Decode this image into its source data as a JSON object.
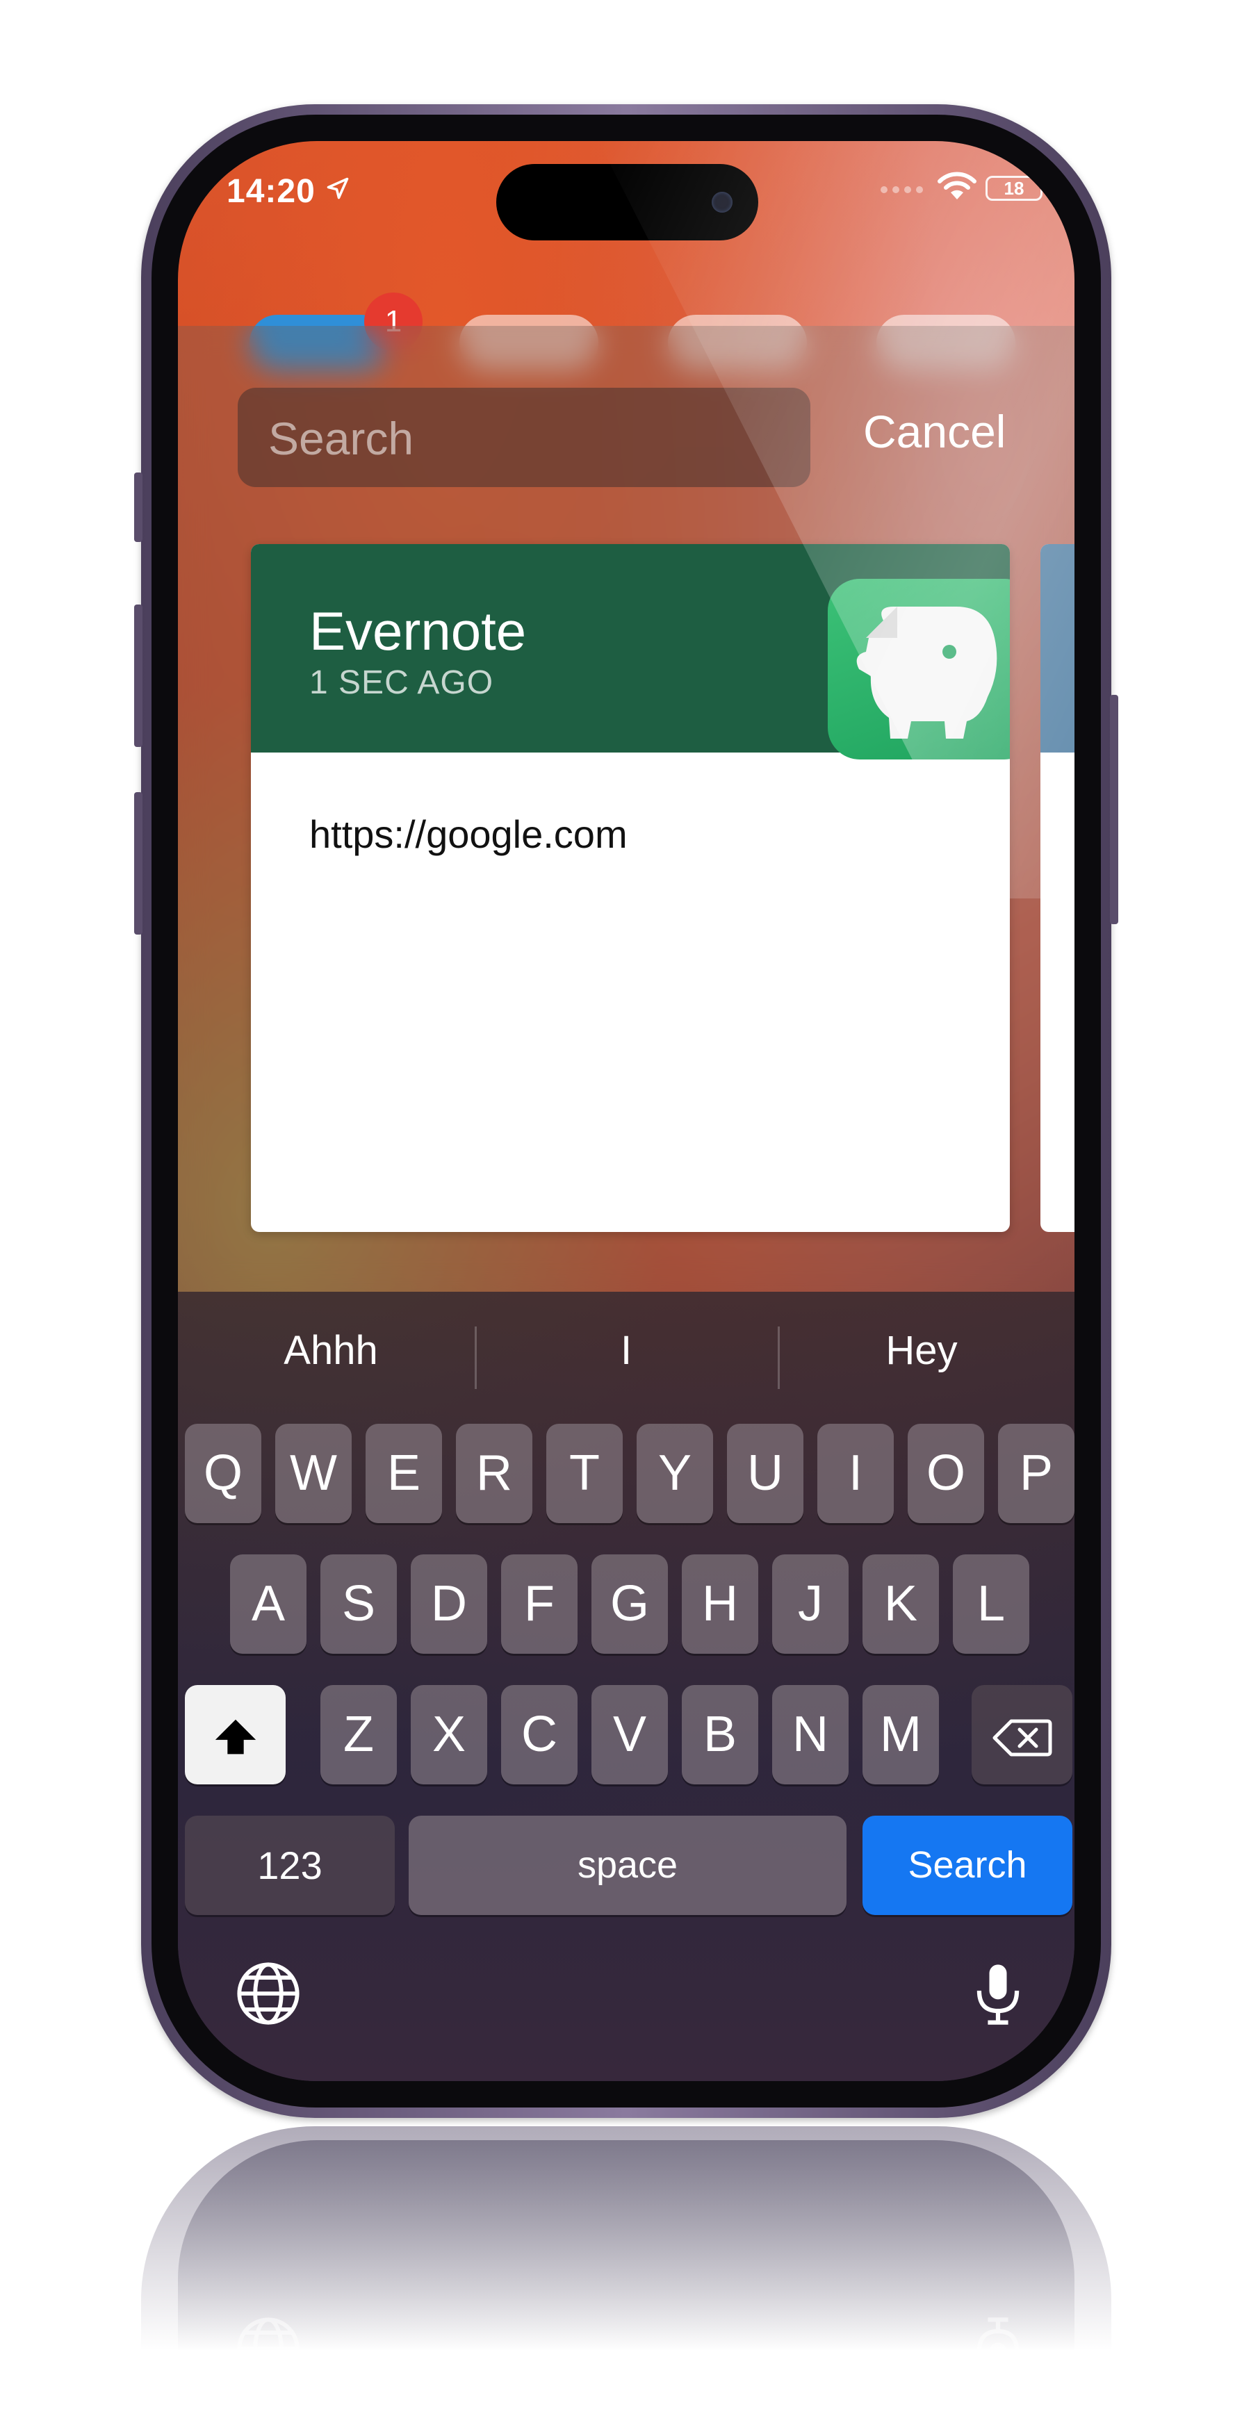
{
  "status_bar": {
    "time": "14:20",
    "battery": "18",
    "icons": [
      "location-arrow-icon",
      "signal-dots-icon",
      "wifi-icon",
      "battery-icon"
    ]
  },
  "home_badge": "1",
  "search": {
    "placeholder": "Search",
    "value": "",
    "cancel_label": "Cancel"
  },
  "card": {
    "app_name": "Evernote",
    "time_ago": "1 SEC AGO",
    "content": "https://google.com",
    "app_icon": "evernote-elephant-icon",
    "header_color": "#1e5e42"
  },
  "keyboard": {
    "suggestions": [
      "Ahhh",
      "I",
      "Hey"
    ],
    "rows": [
      [
        "Q",
        "W",
        "E",
        "R",
        "T",
        "Y",
        "U",
        "I",
        "O",
        "P"
      ],
      [
        "A",
        "S",
        "D",
        "F",
        "G",
        "H",
        "J",
        "K",
        "L"
      ],
      [
        "Z",
        "X",
        "C",
        "V",
        "B",
        "N",
        "M"
      ]
    ],
    "numbers_label": "123",
    "space_label": "space",
    "return_label": "Search",
    "return_color": "#1577f2",
    "icons": [
      "shift-icon",
      "backspace-icon",
      "globe-icon",
      "microphone-icon"
    ]
  }
}
